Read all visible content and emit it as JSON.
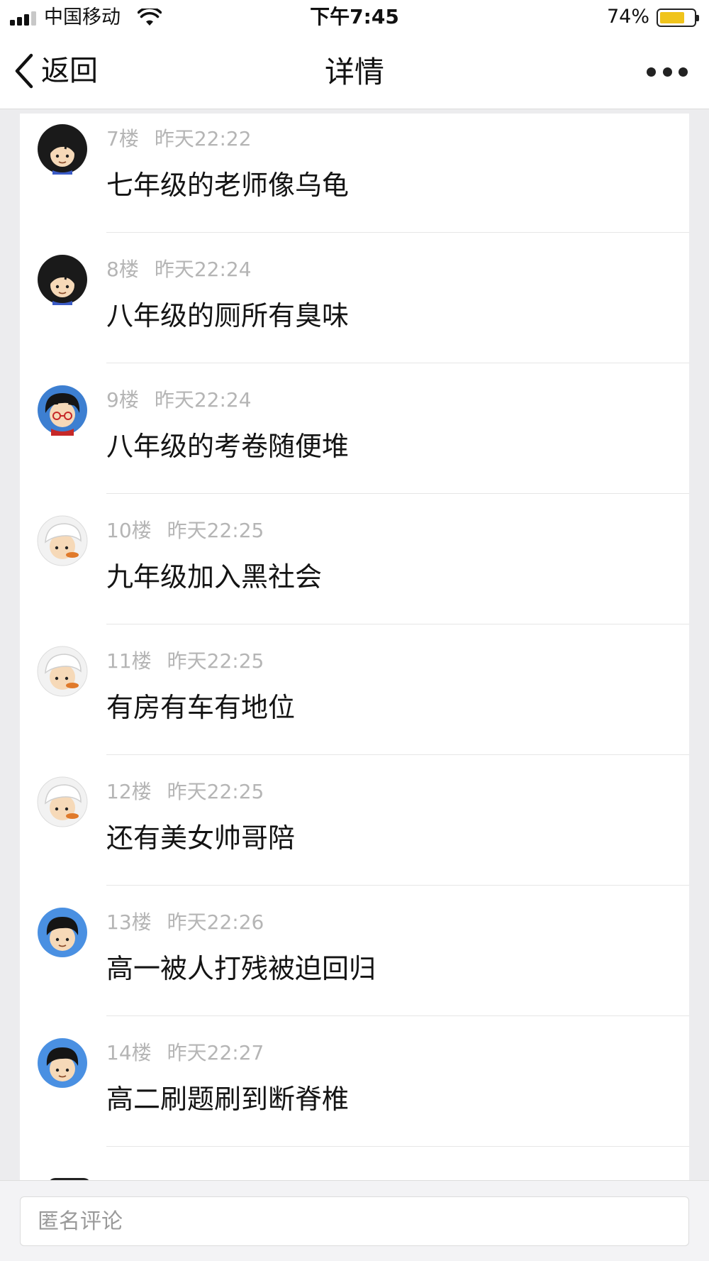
{
  "status_bar": {
    "carrier": "中国移动",
    "time": "下午7:45",
    "battery_percent": "74%",
    "battery_level": 0.74,
    "battery_color": "#f0c41b",
    "icons": [
      "signal-icon",
      "wifi-icon",
      "battery-icon"
    ]
  },
  "nav": {
    "back_label": "返回",
    "title": "详情",
    "back_icon": "chevron-left-icon",
    "more_icon": "more-dots-icon"
  },
  "comments": [
    {
      "floor": "7楼",
      "time": "昨天22:22",
      "text": "七年级的老师像乌龟",
      "avatar": "boy-black-hair"
    },
    {
      "floor": "8楼",
      "time": "昨天22:24",
      "text": "八年级的厕所有臭味",
      "avatar": "boy-black-hair"
    },
    {
      "floor": "9楼",
      "time": "昨天22:24",
      "text": "八年级的考卷随便堆",
      "avatar": "boy-glasses-blue-bg"
    },
    {
      "floor": "10楼",
      "time": "昨天22:25",
      "text": "九年级加入黑社会",
      "avatar": "boy-white-hat"
    },
    {
      "floor": "11楼",
      "time": "昨天22:25",
      "text": "有房有车有地位",
      "avatar": "boy-white-hat"
    },
    {
      "floor": "12楼",
      "time": "昨天22:25",
      "text": "还有美女帅哥陪",
      "avatar": "boy-white-hat"
    },
    {
      "floor": "13楼",
      "time": "昨天22:26",
      "text": "高一被人打残被迫回归",
      "avatar": "boy-blue-bg"
    },
    {
      "floor": "14楼",
      "time": "昨天22:27",
      "text": "高二刷题刷到断脊椎",
      "avatar": "boy-blue-bg"
    }
  ],
  "comment_input": {
    "placeholder": "匿名评论"
  }
}
